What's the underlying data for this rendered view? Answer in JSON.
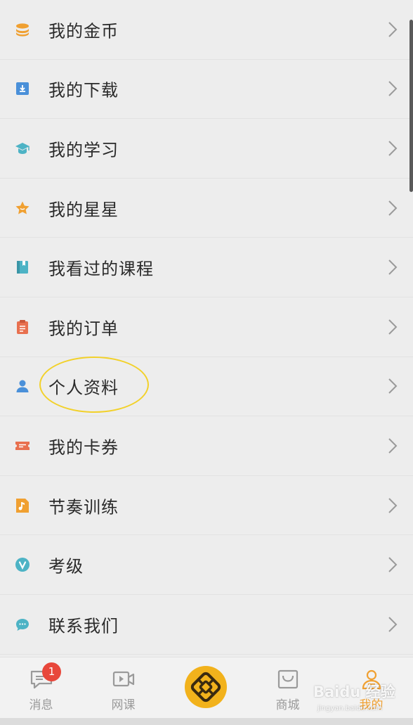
{
  "menu": {
    "items": [
      {
        "label": "我的金币",
        "icon": "coins-icon",
        "color": "#f0a031"
      },
      {
        "label": "我的下载",
        "icon": "download-icon",
        "color": "#4a90d9"
      },
      {
        "label": "我的学习",
        "icon": "graduation-cap-icon",
        "color": "#4db3c5"
      },
      {
        "label": "我的星星",
        "icon": "star-icon",
        "color": "#f0a031"
      },
      {
        "label": "我看过的课程",
        "icon": "book-icon",
        "color": "#4db3c5"
      },
      {
        "label": "我的订单",
        "icon": "clipboard-icon",
        "color": "#e8704f"
      },
      {
        "label": "个人资料",
        "icon": "person-icon",
        "color": "#4a90d9"
      },
      {
        "label": "我的卡券",
        "icon": "ticket-icon",
        "color": "#e8704f"
      },
      {
        "label": "节奏训练",
        "icon": "music-note-icon",
        "color": "#f0a031"
      },
      {
        "label": "考级",
        "icon": "v-badge-icon",
        "color": "#4db3c5"
      },
      {
        "label": "联系我们",
        "icon": "chat-bubble-icon",
        "color": "#4db3c5"
      }
    ]
  },
  "tabbar": {
    "tabs": [
      {
        "label": "消息",
        "icon": "message-icon",
        "active": false
      },
      {
        "label": "网课",
        "icon": "video-icon",
        "active": false
      },
      {
        "label": "",
        "icon": "logo-icon",
        "active": false
      },
      {
        "label": "商城",
        "icon": "shopping-bag-icon",
        "active": false
      },
      {
        "label": "我的",
        "icon": "user-icon",
        "active": true
      }
    ],
    "message_badge": "1"
  },
  "watermark": {
    "text": "Baidu 经验",
    "url": "jingyan.baidu.com"
  },
  "colors": {
    "accent": "#f0a031",
    "badge": "#e8473b",
    "highlight": "#f2d12a"
  }
}
